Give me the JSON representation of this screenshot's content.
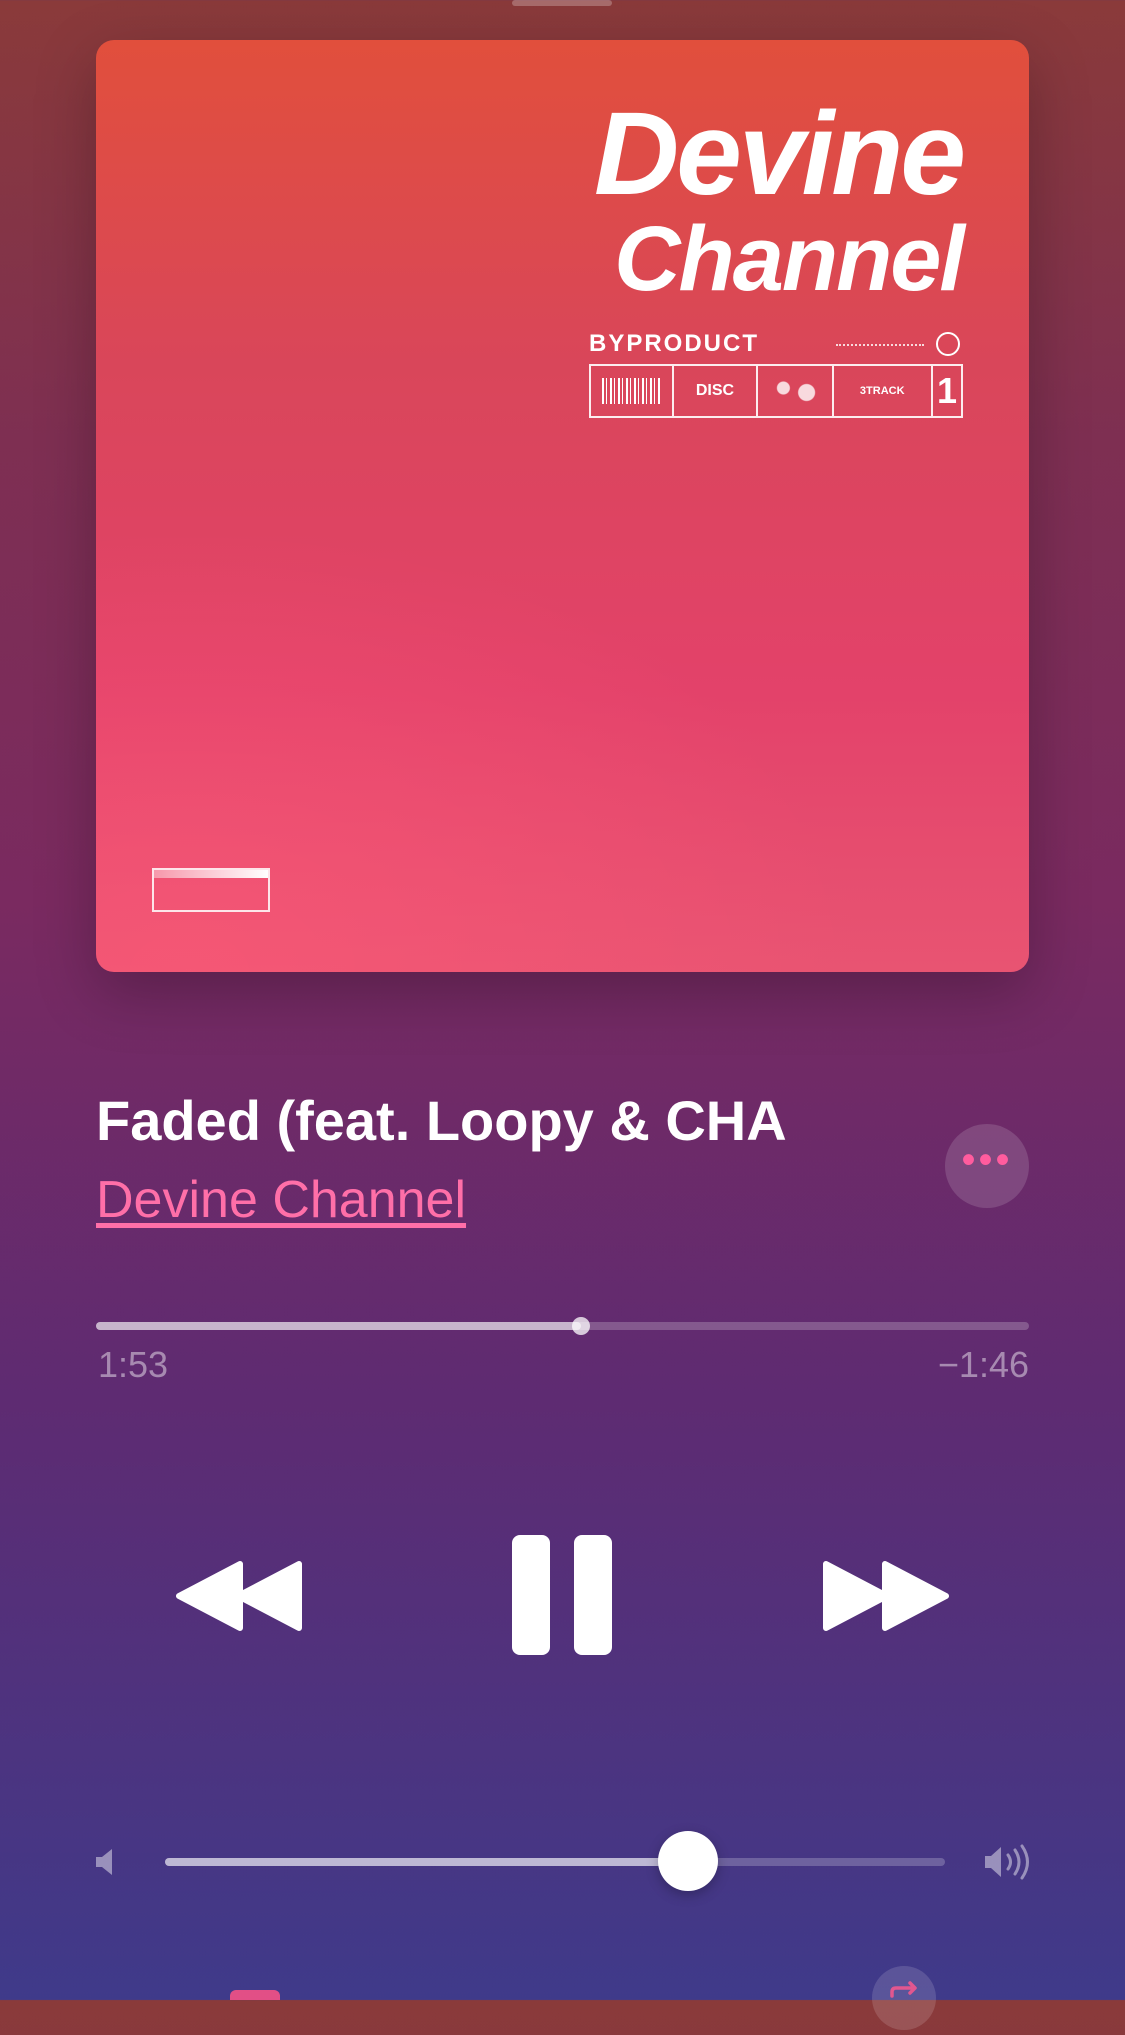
{
  "now_playing": {
    "artwork": {
      "title_line1": "Devine",
      "title_line2": "Channel",
      "subtitle": "BYPRODUCT",
      "disc_label": "DISC",
      "track_label": "3TRACK",
      "number": "1"
    },
    "song_title": "Faded (feat. Loopy & CHA",
    "artist": "Devine Channel",
    "more_icon": "ellipsis-icon",
    "progress": {
      "fraction": 0.52,
      "elapsed": "1:53",
      "remaining": "−1:46"
    },
    "controls": {
      "prev_icon": "rewind-icon",
      "pause_icon": "pause-icon",
      "next_icon": "fast-forward-icon"
    },
    "volume": {
      "fraction": 0.67
    }
  },
  "colors": {
    "accent": "#ff6fa8",
    "artwork_top": "#e14f3c",
    "artwork_bottom": "#e85472"
  }
}
